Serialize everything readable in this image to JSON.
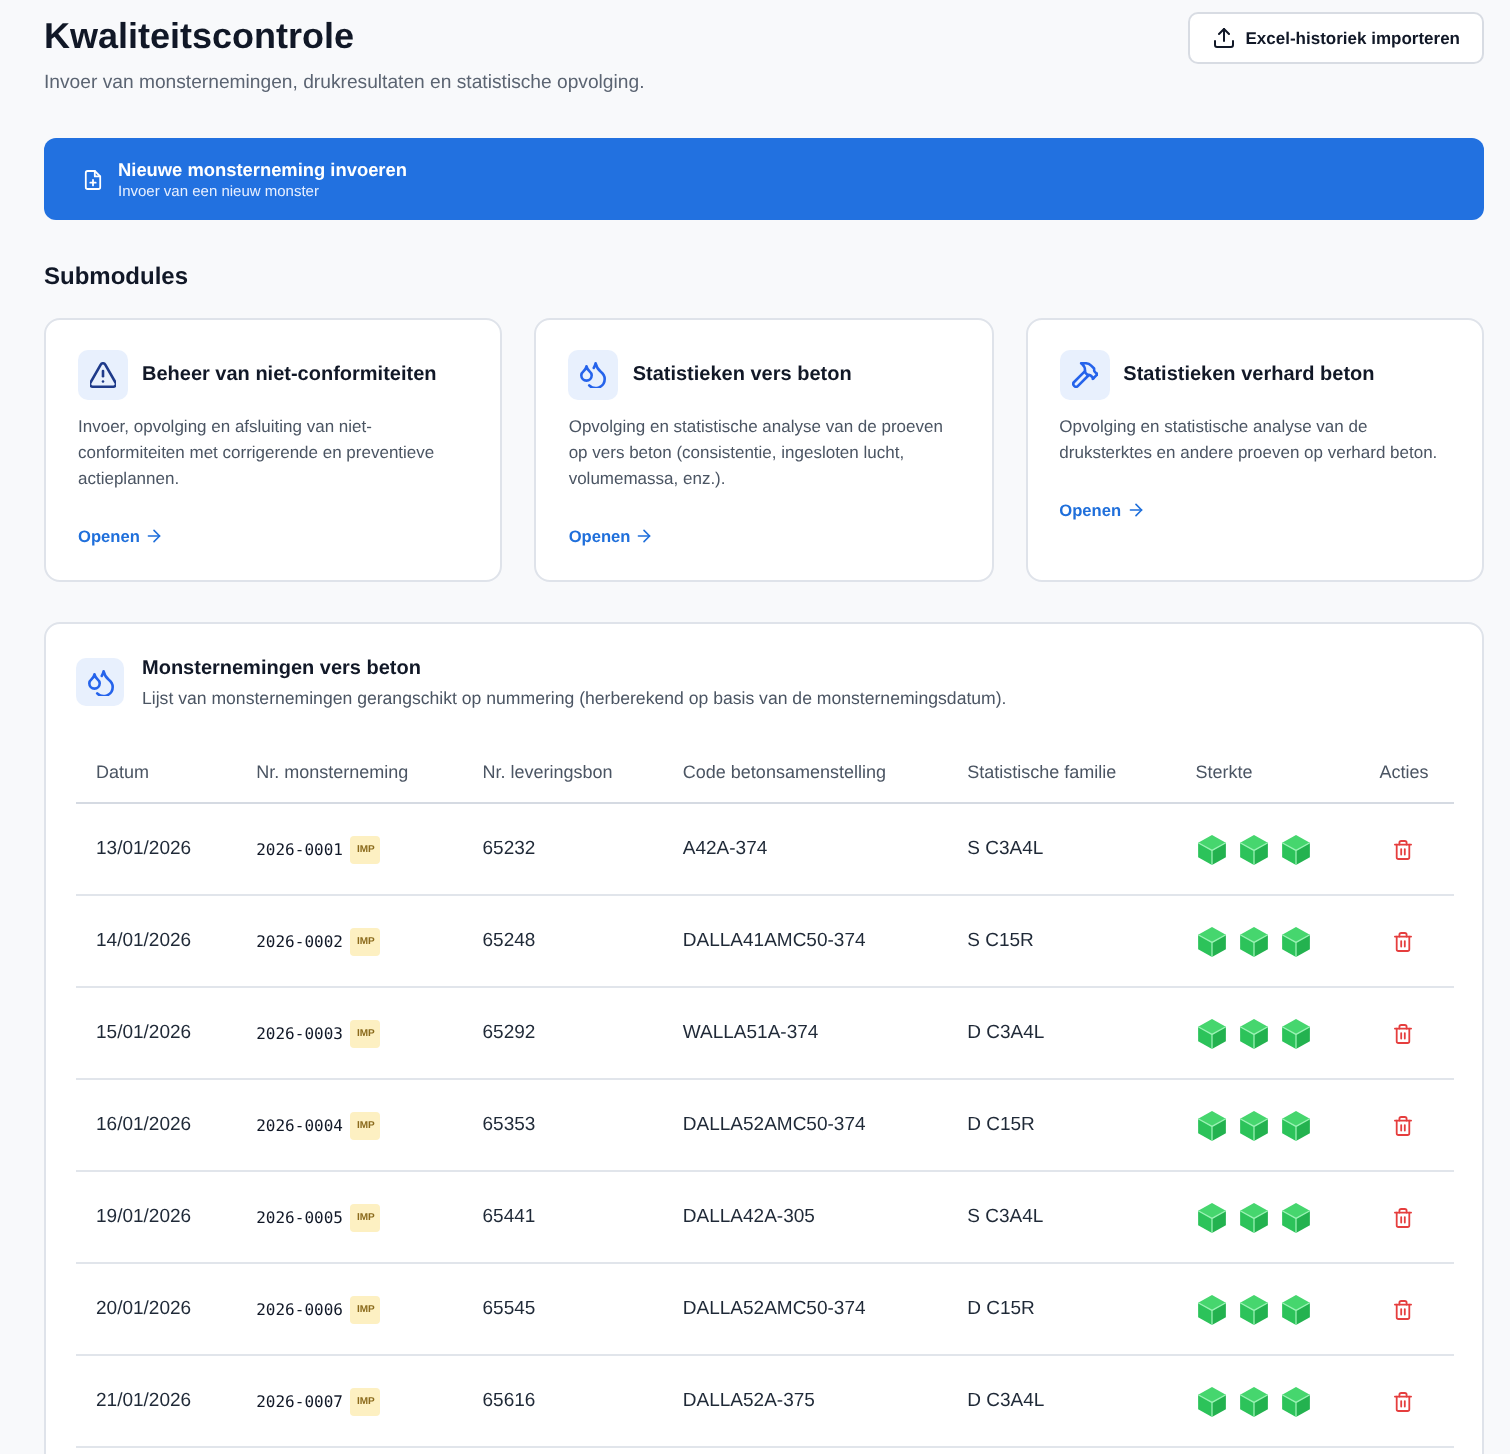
{
  "page": {
    "title": "Kwaliteitscontrole",
    "subtitle": "Invoer van monsternemingen, drukresultaten en statistische opvolging.",
    "import_button": "Excel-historiek importeren"
  },
  "new_sample_banner": {
    "title": "Nieuwe monsterneming invoeren",
    "subtitle": "Invoer van een nieuw monster"
  },
  "submodules": {
    "heading": "Submodules",
    "cards": [
      {
        "kind": "warning",
        "title": "Beheer van niet-conformiteiten",
        "description": "Invoer, opvolging en afsluiting van niet-conformiteiten met corrigerende en preventieve actieplannen.",
        "link": "Openen"
      },
      {
        "kind": "droplets",
        "title": "Statistieken vers beton",
        "description": "Opvolging en statistische analyse van de proeven op vers beton (consistentie, ingesloten lucht, volumemassa, enz.).",
        "link": "Openen"
      },
      {
        "kind": "hammer",
        "title": "Statistieken verhard beton",
        "description": "Opvolging en statistische analyse van de druksterktes en andere proeven op verhard beton.",
        "link": "Openen"
      }
    ]
  },
  "samples_table": {
    "title": "Monsternemingen vers beton",
    "description": "Lijst van monsternemingen gerangschikt op nummering (herberekend op basis van de monsternemingsdatum).",
    "columns": [
      "Datum",
      "Nr. monsterneming",
      "Nr. leveringsbon",
      "Code betonsamenstelling",
      "Statistische familie",
      "Sterkte",
      "Acties"
    ],
    "rows": [
      {
        "date": "13/01/2026",
        "sample_number": "2026-0001",
        "badge": "IMP",
        "delivery_note": "65232",
        "mix_code": "A42A-374",
        "family": "S C3A4L",
        "stars": 3
      },
      {
        "date": "14/01/2026",
        "sample_number": "2026-0002",
        "badge": "IMP",
        "delivery_note": "65248",
        "mix_code": "DALLA41AMC50-374",
        "family": "S C15R",
        "stars": 3
      },
      {
        "date": "15/01/2026",
        "sample_number": "2026-0003",
        "badge": "IMP",
        "delivery_note": "65292",
        "mix_code": "WALLA51A-374",
        "family": "D C3A4L",
        "stars": 3
      },
      {
        "date": "16/01/2026",
        "sample_number": "2026-0004",
        "badge": "IMP",
        "delivery_note": "65353",
        "mix_code": "DALLA52AMC50-374",
        "family": "D C15R",
        "stars": 3
      },
      {
        "date": "19/01/2026",
        "sample_number": "2026-0005",
        "badge": "IMP",
        "delivery_note": "65441",
        "mix_code": "DALLA42A-305",
        "family": "S C3A4L",
        "stars": 3
      },
      {
        "date": "20/01/2026",
        "sample_number": "2026-0006",
        "badge": "IMP",
        "delivery_note": "65545",
        "mix_code": "DALLA52AMC50-374",
        "family": "D C15R",
        "stars": 3
      },
      {
        "date": "21/01/2026",
        "sample_number": "2026-0007",
        "badge": "IMP",
        "delivery_note": "65616",
        "mix_code": "DALLA52A-375",
        "family": "D C3A4L",
        "stars": 3
      }
    ]
  }
}
